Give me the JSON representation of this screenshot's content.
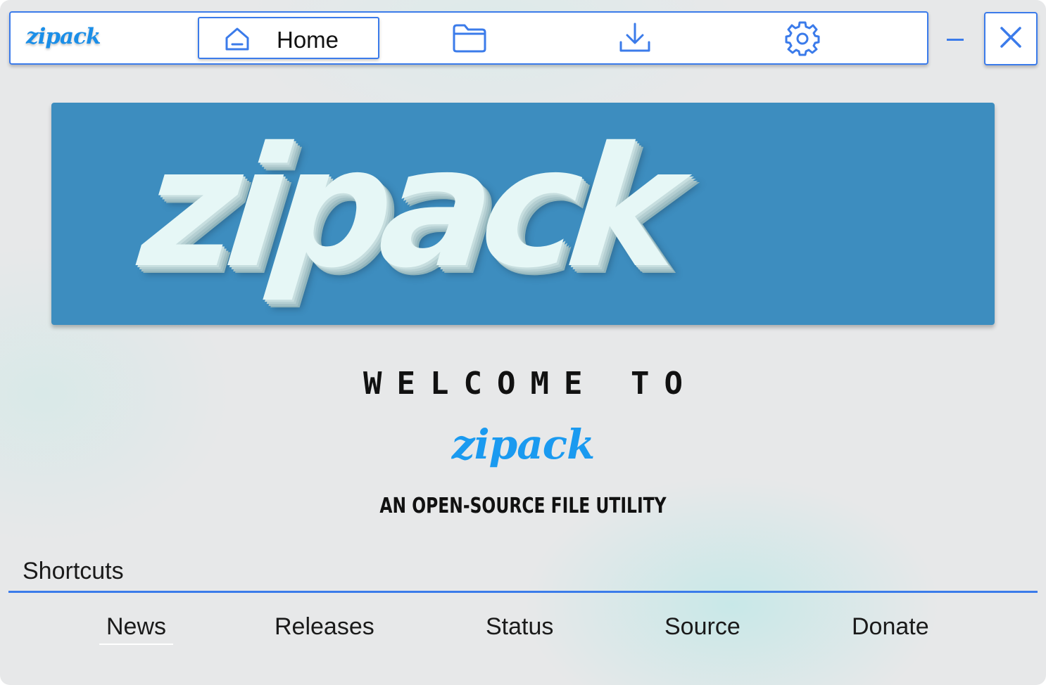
{
  "app": {
    "brand": "zipack"
  },
  "navbar": {
    "items": [
      {
        "label": "Home",
        "icon": "home-icon",
        "active": true
      },
      {
        "label": "",
        "icon": "folder-icon",
        "active": false
      },
      {
        "label": "",
        "icon": "download-icon",
        "active": false
      },
      {
        "label": "",
        "icon": "gear-icon",
        "active": false
      }
    ]
  },
  "window_controls": {
    "minimize_icon": "minimize-icon",
    "close_icon": "close-icon"
  },
  "hero": {
    "banner_text": "zipack",
    "banner_color": "#3d8dbf"
  },
  "welcome": {
    "heading": "WELCOME TO",
    "brand": "zipack",
    "tagline": "AN OPEN-SOURCE FILE UTILITY"
  },
  "shortcuts": {
    "title": "Shortcuts",
    "items": [
      {
        "label": "News",
        "active": true
      },
      {
        "label": "Releases",
        "active": false
      },
      {
        "label": "Status",
        "active": false
      },
      {
        "label": "Source",
        "active": false
      },
      {
        "label": "Donate",
        "active": false
      }
    ]
  },
  "colors": {
    "accent": "#3b7bea",
    "brand": "#1a9af0",
    "background": "#e7e8e9"
  }
}
